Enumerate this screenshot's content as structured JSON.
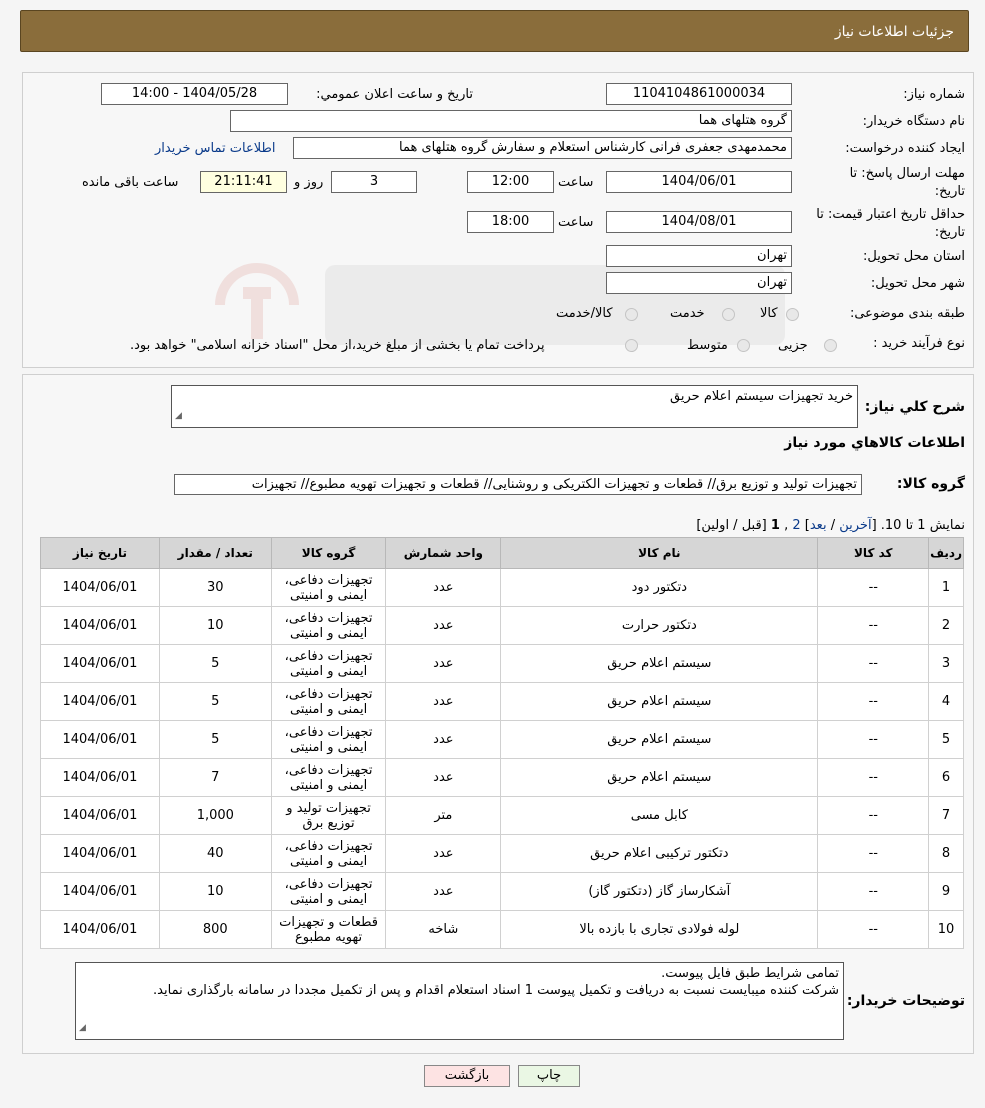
{
  "header": {
    "title": "جزئیات اطلاعات نیاز"
  },
  "form": {
    "need_number_label": "شماره نیاز:",
    "need_number": "1104104861000034",
    "announce_label": "تاریخ و ساعت اعلان عمومي:",
    "announce_value": "1404/05/28 - 14:00",
    "buyer_org_label": "نام دستگاه خریدار:",
    "buyer_org": "گروه هتلهای هما",
    "creator_label": "ایجاد کننده درخواست:",
    "creator": "محمدمهدی جعفری فرانی کارشناس استعلام و سفارش گروه هتلهای هما",
    "contact_link": "اطلاعات تماس خریدار",
    "reply_deadline_label_1": "مهلت ارسال پاسخ: تا",
    "reply_deadline_label_2": "تاریخ:",
    "reply_date": "1404/06/01",
    "time_label": "ساعت",
    "reply_time": "12:00",
    "days": "3",
    "days_label": "روز و",
    "remaining": "21:11:41",
    "remaining_label": "ساعت باقی مانده",
    "price_validity_label_1": "حداقل تاریخ اعتبار قیمت: تا",
    "price_validity_label_2": "تاریخ:",
    "price_date": "1404/08/01",
    "price_time": "18:00",
    "province_label": "استان محل تحویل:",
    "province": "تهران",
    "city_label": "شهر محل تحویل:",
    "city": "تهران",
    "category_label": "طبقه بندی موضوعی:",
    "category_options": [
      "کالا",
      "خدمت",
      "کالا/خدمت"
    ],
    "process_label": "نوع فرآیند خرید :",
    "process_options": [
      "جزیی",
      "متوسط"
    ],
    "process_note": "پرداخت تمام یا بخشی از مبلغ خرید،از محل \"اسناد خزانه اسلامی\" خواهد بود."
  },
  "description": {
    "label": "شرح کلي نياز:",
    "value": "خرید تجهیزات سیستم اعلام حریق"
  },
  "goods": {
    "section_title": "اطلاعات کالاهاي مورد نياز",
    "group_label": "گروه کالا:",
    "group_value": "تجهیزات تولید و توزیع برق// قطعات و تجهیزات الکتریکی و روشنایی//  قطعات و تجهیزات تهویه مطبوع// تجهیزات",
    "pagination_prefix": "نمایش 1 تا 10. [",
    "pagination_last": "آخرین",
    "pagination_sep1": " / ",
    "pagination_next": "بعد",
    "pagination_sep2": "] ",
    "pagination_page2": "2",
    "pagination_comma": " ,",
    "pagination_page1": "1",
    "pagination_suffix": " [قبل / اولین]",
    "columns": [
      "ردیف",
      "کد کالا",
      "نام کالا",
      "واحد شمارش",
      "گروه کالا",
      "تعداد / مقدار",
      "تاریخ نیاز"
    ],
    "rows": [
      [
        "1",
        "--",
        "دتکتور دود",
        "عدد",
        "تجهیزات دفاعی، ایمنی و امنیتی",
        "30",
        "1404/06/01"
      ],
      [
        "2",
        "--",
        "دتکتور حرارت",
        "عدد",
        "تجهیزات دفاعی، ایمنی و امنیتی",
        "10",
        "1404/06/01"
      ],
      [
        "3",
        "--",
        "سیستم اعلام حریق",
        "عدد",
        "تجهیزات دفاعی، ایمنی و امنیتی",
        "5",
        "1404/06/01"
      ],
      [
        "4",
        "--",
        "سیستم اعلام حریق",
        "عدد",
        "تجهیزات دفاعی، ایمنی و امنیتی",
        "5",
        "1404/06/01"
      ],
      [
        "5",
        "--",
        "سیستم اعلام حریق",
        "عدد",
        "تجهیزات دفاعی، ایمنی و امنیتی",
        "5",
        "1404/06/01"
      ],
      [
        "6",
        "--",
        "سیستم اعلام حریق",
        "عدد",
        "تجهیزات دفاعی، ایمنی و امنیتی",
        "7",
        "1404/06/01"
      ],
      [
        "7",
        "--",
        "کابل مسی",
        "متر",
        "تجهیزات تولید و توزیع برق",
        "1,000",
        "1404/06/01"
      ],
      [
        "8",
        "--",
        "دتکتور ترکیبی اعلام حریق",
        "عدد",
        "تجهیزات دفاعی، ایمنی و امنیتی",
        "40",
        "1404/06/01"
      ],
      [
        "9",
        "--",
        "آشکارساز گاز (دتکتور گاز)",
        "عدد",
        "تجهیزات دفاعی، ایمنی و امنیتی",
        "10",
        "1404/06/01"
      ],
      [
        "10",
        "--",
        "لوله فولادی تجاری با بازده بالا",
        "شاخه",
        "قطعات و تجهیزات تهویه مطبوع",
        "800",
        "1404/06/01"
      ]
    ]
  },
  "buyer_notes": {
    "label": "توضیحات خریدار:",
    "line1": "تمامی شرایط طبق فایل پیوست.",
    "line2": "شرکت کننده میبایست نسبت به دریافت و تکمیل پیوست 1 اسناد استعلام اقدام و پس از تکمیل مجددا در سامانه بارگذاری نماید."
  },
  "buttons": {
    "print": "چاپ",
    "back": "بازگشت"
  },
  "colors": {
    "header_bg": "#8a6d3b",
    "link": "#0a3a8a",
    "back_button": "#fde3e3",
    "print_button": "#eaf7e4"
  }
}
